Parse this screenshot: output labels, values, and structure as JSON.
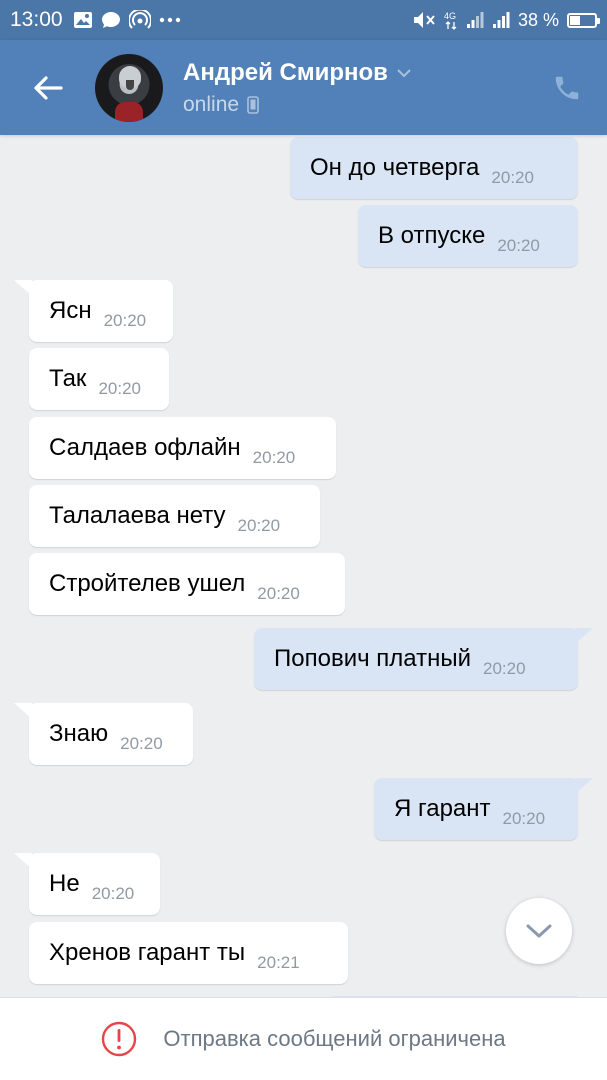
{
  "status_bar": {
    "time": "13:00",
    "left_icons": [
      "image-icon",
      "chat-bubble-icon",
      "hotspot-icon",
      "more-dots-icon"
    ],
    "right_icons": [
      "mute-icon",
      "network-4g-icon",
      "signal-icon",
      "signal-icon"
    ],
    "battery_text": "38 %",
    "battery_level": 0.38
  },
  "header": {
    "contact_name": "Андрей Смирнов",
    "status": "online",
    "back_icon": "arrow-left-icon",
    "call_icon": "phone-icon",
    "status_icon": "mobile-phone-icon"
  },
  "messages": [
    {
      "dir": "out",
      "text": "Он до четверга",
      "time": "20:20"
    },
    {
      "dir": "out",
      "text": "В отпуске",
      "time": "20:20"
    },
    {
      "dir": "in",
      "text": "Ясн",
      "time": "20:20"
    },
    {
      "dir": "in",
      "text": "Так",
      "time": "20:20"
    },
    {
      "dir": "in",
      "text": "Салдаев офлайн",
      "time": "20:20"
    },
    {
      "dir": "in",
      "text": "Талалаева нету",
      "time": "20:20"
    },
    {
      "dir": "in",
      "text": "Стройтелев ушел",
      "time": "20:20"
    },
    {
      "dir": "out",
      "text": "Попович платный",
      "time": "20:20"
    },
    {
      "dir": "in",
      "text": "Знаю",
      "time": "20:20"
    },
    {
      "dir": "out",
      "text": "Я гарант",
      "time": "20:20"
    },
    {
      "dir": "in",
      "text": "Не",
      "time": "20:20"
    },
    {
      "dir": "in",
      "text": "Хренов гарант ты",
      "time": "20:21"
    }
  ],
  "bottom_bar": {
    "message": "Отправка сообщений ограничена",
    "icon": "alert-circle-icon",
    "icon_color": "#e64646"
  },
  "colors": {
    "header": "#5181b8",
    "status_bar": "#4a76a8",
    "outgoing_bubble": "#d9e5f5",
    "incoming_bubble": "#ffffff",
    "background": "#edeef0"
  }
}
